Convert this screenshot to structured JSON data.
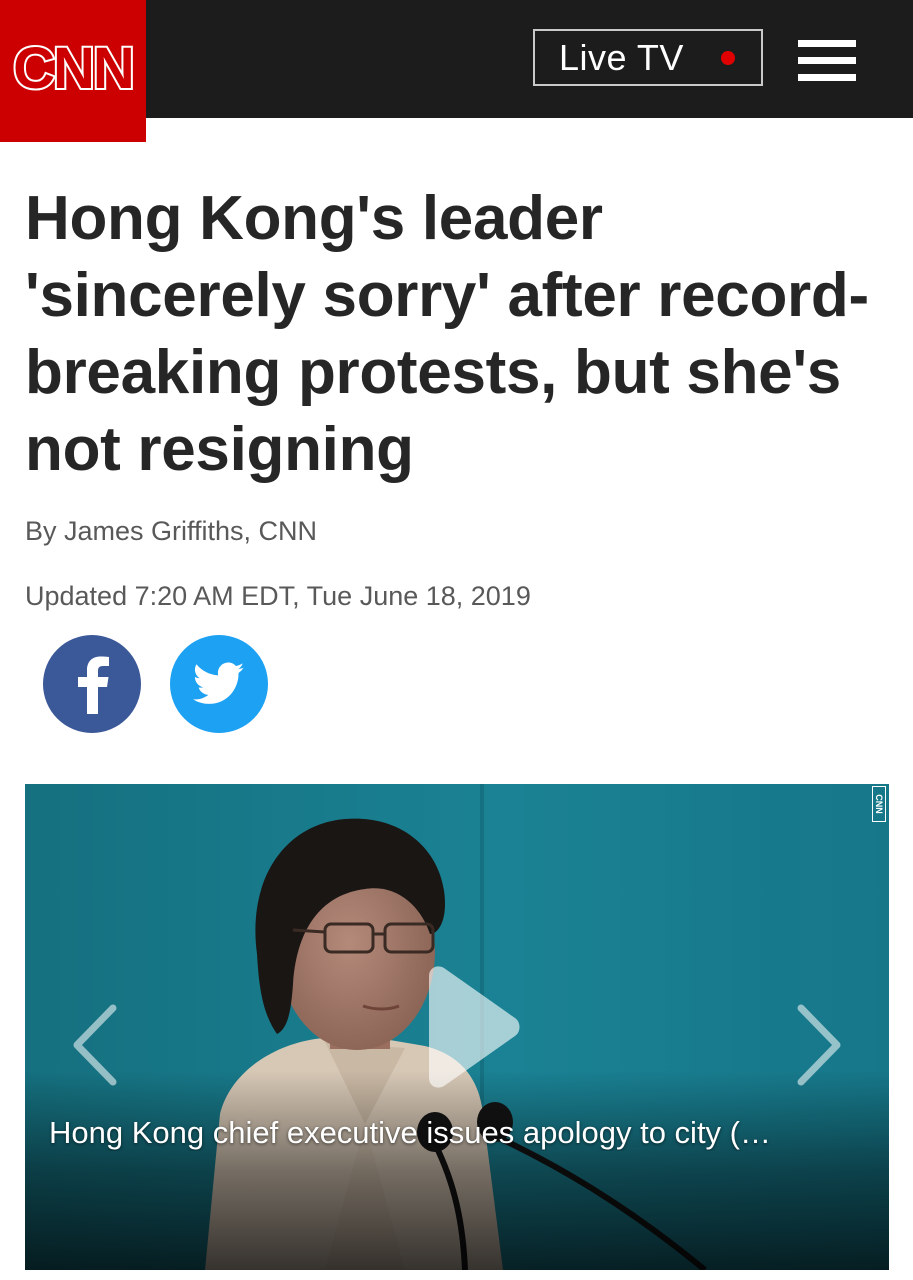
{
  "header": {
    "logo_text": "CNN",
    "live_tv_label": "Live TV",
    "menu_icon": "hamburger-menu-icon"
  },
  "article": {
    "headline": "Hong Kong's leader 'sincerely sorry' after record-breaking protests, but she's not resigning",
    "byline": "By James Griffiths, CNN",
    "timestamp": "Updated 7:20 AM EDT, Tue June 18, 2019"
  },
  "share": {
    "facebook_icon": "facebook-icon",
    "twitter_icon": "twitter-icon"
  },
  "video": {
    "caption": "Hong Kong chief executive issues apology to city (…",
    "watermark": "CNN",
    "play_icon": "play-icon",
    "prev_icon": "chevron-left-icon",
    "next_icon": "chevron-right-icon"
  },
  "colors": {
    "brand_red": "#cc0000",
    "header_bg": "#1c1c1c",
    "facebook_blue": "#3b5998",
    "twitter_blue": "#1da1f2",
    "live_dot": "#e00000"
  }
}
